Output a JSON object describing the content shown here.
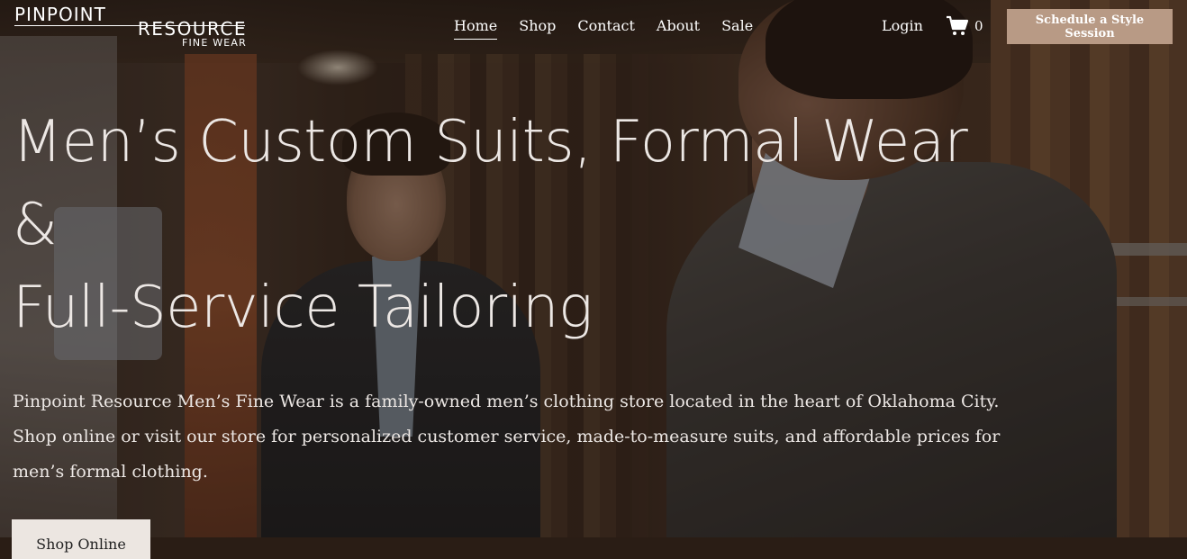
{
  "logo": {
    "line1": "PINPOINT",
    "line2": "RESOURCE",
    "line3": "FINE WEAR"
  },
  "nav": {
    "items": [
      {
        "label": "Home",
        "active": true
      },
      {
        "label": "Shop"
      },
      {
        "label": "Contact"
      },
      {
        "label": "About"
      },
      {
        "label": "Sale"
      }
    ]
  },
  "account": {
    "login_label": "Login",
    "cart_icon": "cart-icon",
    "cart_count": "0"
  },
  "cta": {
    "label": "Schedule a Style Session"
  },
  "hero": {
    "title_line1": "Men’s Custom Suits, Formal Wear",
    "title_line2": "&",
    "title_line3": "Full-Service Tailoring",
    "description": "Pinpoint Resource Men’s Fine Wear is a family-owned men’s clothing store located in the heart of Oklahoma City. Shop online or visit our store for personalized customer service, made-to-measure suits, and affordable prices for men’s formal clothing.",
    "shop_button": "Shop Online"
  },
  "colors": {
    "cta_background": "#b89a85",
    "text": "#ece7e4"
  }
}
